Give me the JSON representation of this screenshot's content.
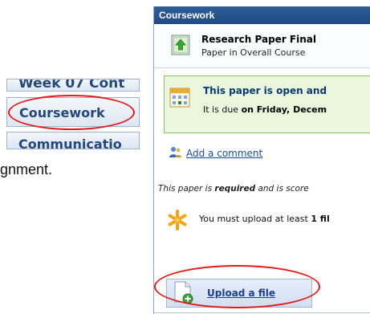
{
  "nav_snippet": {
    "items": [
      "Week 07 Cont",
      "Coursework",
      "Communicatio"
    ],
    "highlighted": "Coursework"
  },
  "caption_fragment": "gnment.",
  "panel": {
    "title": "Coursework",
    "item": {
      "title": "Research Paper Final",
      "subtitle": "Paper in Overall Course",
      "icon": "paper-upload-icon"
    },
    "notice": {
      "title": "This paper is open and",
      "due_prefix": "It is due",
      "due_bold": "on Friday, Decem",
      "icon": "calendar-icon"
    },
    "comment_link": "Add a comment",
    "required": {
      "prefix": "This paper is",
      "bold": "required",
      "suffix": "and is score"
    },
    "upload_note": {
      "prefix": "You must upload at least",
      "bold": "1 fil"
    },
    "upload_button": "Upload a file"
  },
  "colors": {
    "header_blue": "#2f5e99",
    "highlight_red": "#e01c1c",
    "notice_green": "#eaf7dc",
    "link_blue": "#1a4ea0"
  }
}
